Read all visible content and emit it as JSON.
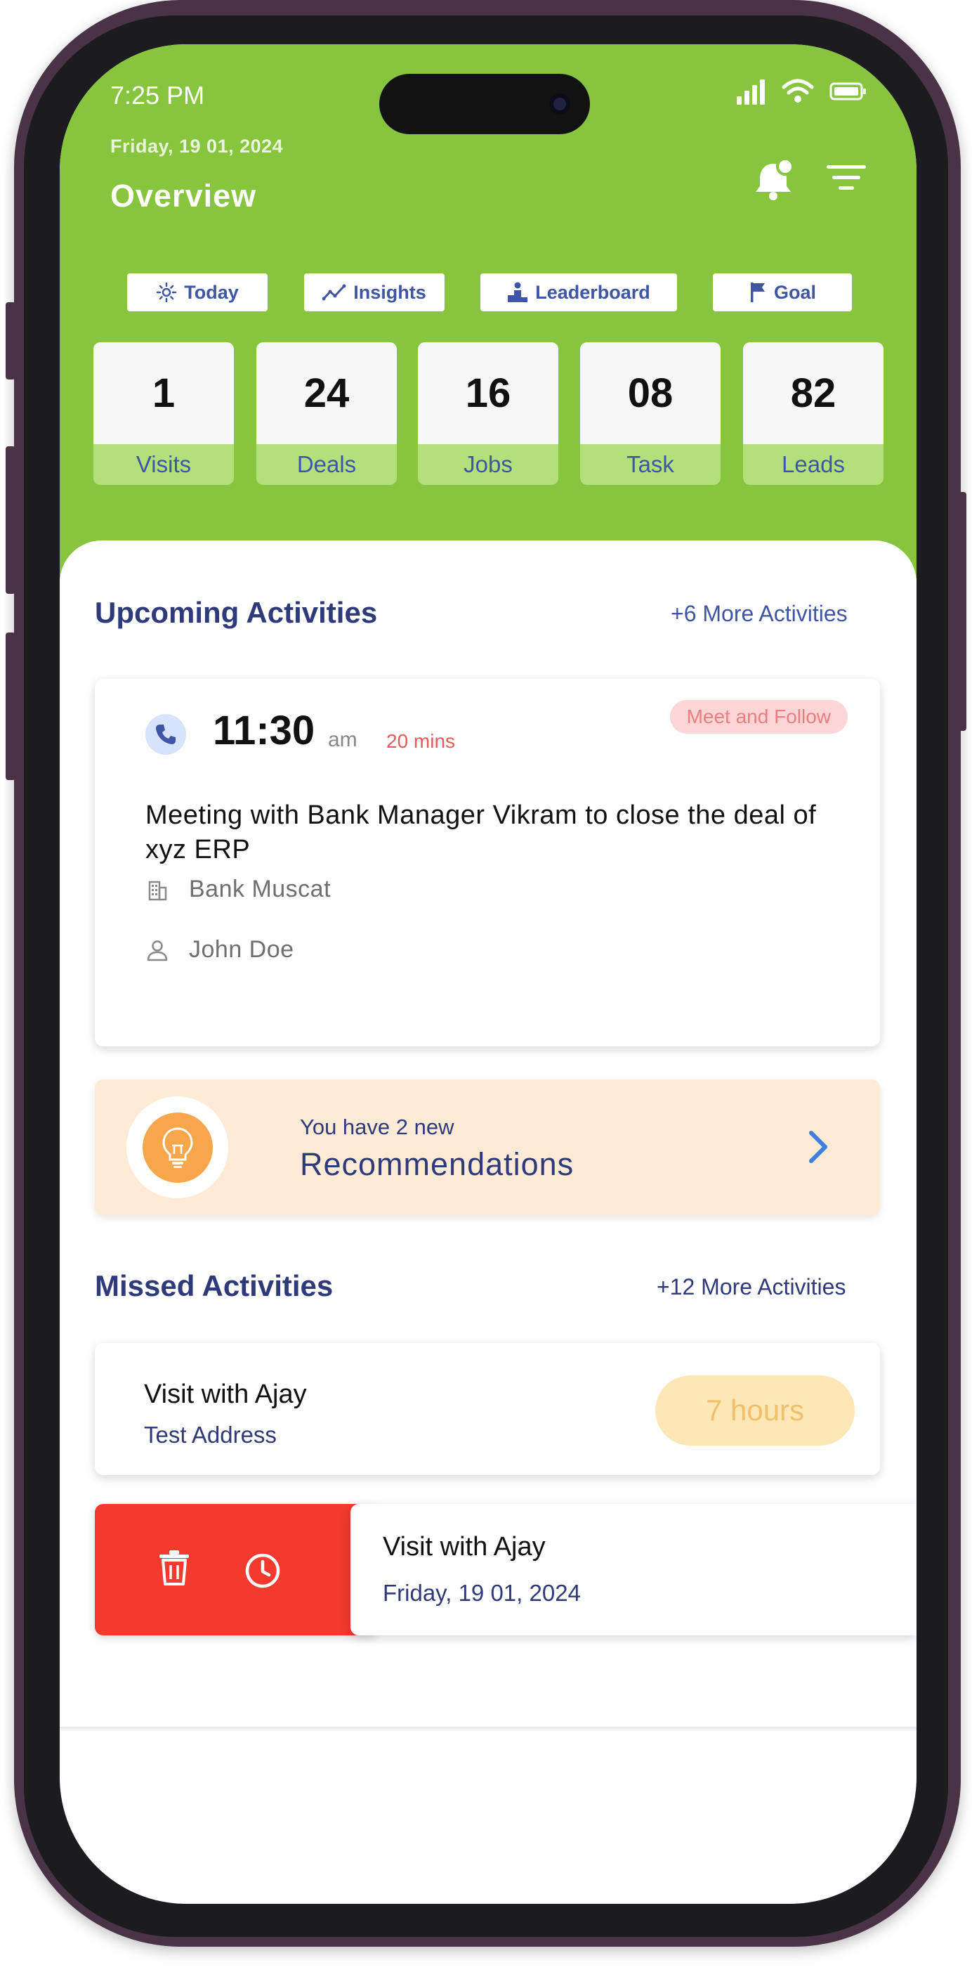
{
  "status_bar": {
    "time": "7:25 PM"
  },
  "header": {
    "date": "Friday, 19 01, 2024",
    "title": "Overview"
  },
  "chips": [
    {
      "label": "Today",
      "icon": "sun-icon"
    },
    {
      "label": "Insights",
      "icon": "trend-icon"
    },
    {
      "label": "Leaderboard",
      "icon": "podium-icon"
    },
    {
      "label": "Goal",
      "icon": "flag-icon"
    }
  ],
  "stats": [
    {
      "value": "1",
      "label": "Visits"
    },
    {
      "value": "24",
      "label": "Deals"
    },
    {
      "value": "16",
      "label": "Jobs"
    },
    {
      "value": "08",
      "label": "Task"
    },
    {
      "value": "82",
      "label": "Leads"
    }
  ],
  "upcoming": {
    "title": "Upcoming Activities",
    "more_link": "+6 More Activities",
    "activity": {
      "time": "11:30",
      "ampm": "am",
      "duration": "20 mins",
      "tag": "Meet and Follow",
      "description": "Meeting with Bank Manager Vikram to close the deal of xyz ERP",
      "company": "Bank Muscat",
      "contact": "John Doe"
    }
  },
  "recommendations": {
    "line1": "You have 2 new",
    "line2": "Recommendations"
  },
  "missed": {
    "title": "Missed Activities",
    "more_link": "+12 More Activities",
    "items": [
      {
        "title": "Visit with Ajay",
        "subtitle": "Test Address",
        "badge": "7 hours"
      },
      {
        "title": "Visit with Ajay",
        "subtitle": "Friday, 19 01, 2024"
      }
    ]
  },
  "colors": {
    "header_green": "#88c53f",
    "navy": "#2f3a7b",
    "link_blue": "#3f56a6",
    "danger_red": "#f43a2e",
    "reco_bg": "#fdebd6"
  }
}
